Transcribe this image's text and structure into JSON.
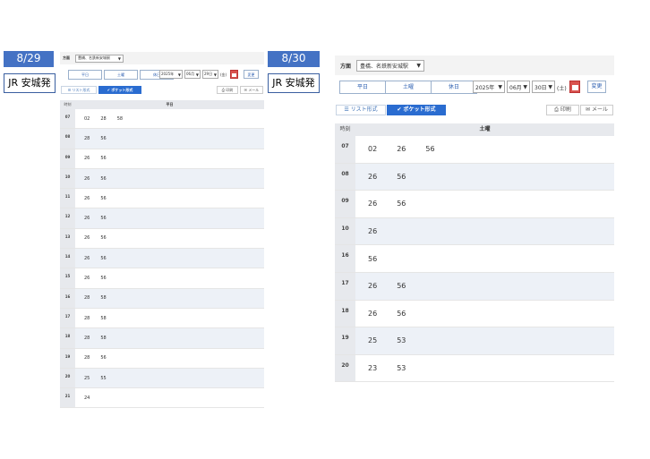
{
  "left": {
    "date_label": "8/29",
    "station_label": "JR 安城発",
    "direction_label": "方面",
    "direction_value": "豊橋、名鉄新安城駅",
    "day_buttons": [
      "平日",
      "土曜",
      "休日"
    ],
    "year": "2025年",
    "month": "06月",
    "day": "29日",
    "weekday": "(金)",
    "change_label": "変更",
    "list_tab": "リスト形式",
    "pocket_tab": "ポケット形式",
    "print_label": "印刷",
    "mail_label": "メール",
    "hour_header": "時刻",
    "day_header": "平日",
    "rows": [
      {
        "hour": "07",
        "minutes": [
          "02",
          "28",
          "58"
        ]
      },
      {
        "hour": "08",
        "minutes": [
          "28",
          "56"
        ]
      },
      {
        "hour": "09",
        "minutes": [
          "26",
          "56"
        ]
      },
      {
        "hour": "10",
        "minutes": [
          "26",
          "56"
        ]
      },
      {
        "hour": "11",
        "minutes": [
          "26",
          "56"
        ]
      },
      {
        "hour": "12",
        "minutes": [
          "26",
          "56"
        ]
      },
      {
        "hour": "13",
        "minutes": [
          "26",
          "56"
        ]
      },
      {
        "hour": "14",
        "minutes": [
          "26",
          "56"
        ]
      },
      {
        "hour": "15",
        "minutes": [
          "26",
          "56"
        ]
      },
      {
        "hour": "16",
        "minutes": [
          "28",
          "58"
        ]
      },
      {
        "hour": "17",
        "minutes": [
          "28",
          "58"
        ]
      },
      {
        "hour": "18",
        "minutes": [
          "28",
          "58"
        ]
      },
      {
        "hour": "19",
        "minutes": [
          "28",
          "56"
        ]
      },
      {
        "hour": "20",
        "minutes": [
          "25",
          "55"
        ]
      },
      {
        "hour": "21",
        "minutes": [
          "24"
        ]
      }
    ]
  },
  "right": {
    "date_label": "8/30",
    "station_label": "JR 安城発",
    "direction_label": "方面",
    "direction_value": "豊橋、名鉄新安城駅",
    "day_buttons": [
      "平日",
      "土曜",
      "休日"
    ],
    "year": "2025年",
    "month": "06月",
    "day": "30日",
    "weekday": "(土)",
    "change_label": "変更",
    "list_tab": "リスト形式",
    "pocket_tab": "ポケット形式",
    "print_label": "印刷",
    "mail_label": "メール",
    "hour_header": "時刻",
    "day_header": "土曜",
    "rows": [
      {
        "hour": "07",
        "minutes": [
          "02",
          "26",
          "56"
        ]
      },
      {
        "hour": "08",
        "minutes": [
          "26",
          "56"
        ]
      },
      {
        "hour": "09",
        "minutes": [
          "26",
          "56"
        ]
      },
      {
        "hour": "10",
        "minutes": [
          "26"
        ]
      },
      {
        "hour": "16",
        "minutes": [
          "56"
        ]
      },
      {
        "hour": "17",
        "minutes": [
          "26",
          "56"
        ]
      },
      {
        "hour": "18",
        "minutes": [
          "26",
          "56"
        ]
      },
      {
        "hour": "19",
        "minutes": [
          "25",
          "53"
        ]
      },
      {
        "hour": "20",
        "minutes": [
          "23",
          "53"
        ]
      }
    ]
  },
  "icons": {
    "calendar": "calendar-icon",
    "check": "check-icon",
    "list": "list-icon",
    "print": "printer-icon",
    "mail": "mail-icon",
    "dropdown": "caret-down-icon"
  },
  "colors": {
    "badge": "#4472c4",
    "pocket_tab": "#2a6cd0",
    "alt_row": "#edf1f7",
    "calendar": "#d9534f"
  }
}
